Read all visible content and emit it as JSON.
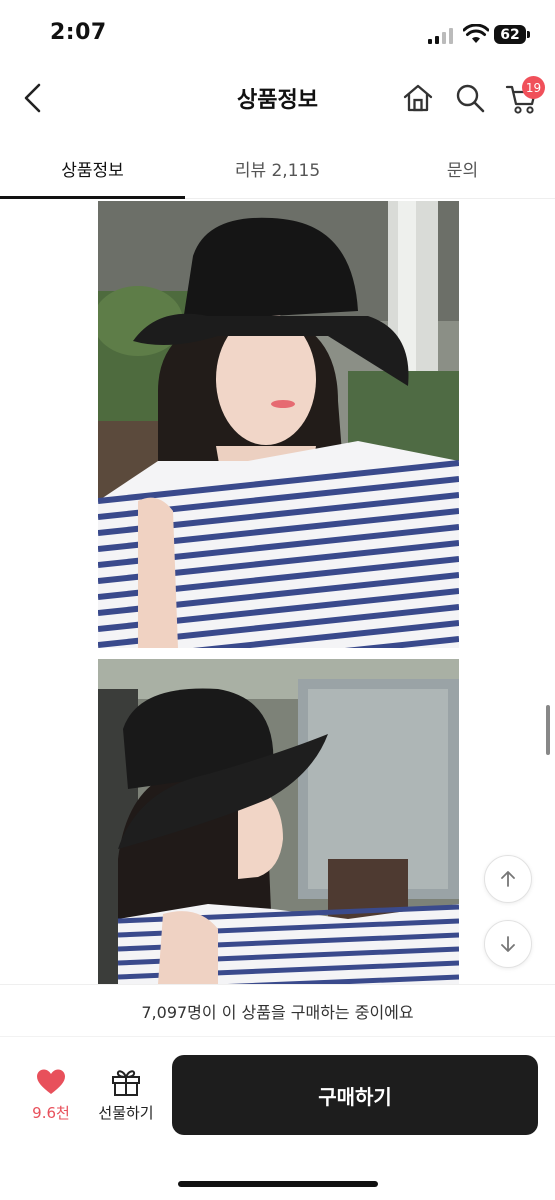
{
  "status": {
    "time": "2:07",
    "battery": "62"
  },
  "header": {
    "title": "상품정보",
    "cart_count": "19"
  },
  "tabs": [
    {
      "label": "상품정보",
      "active": true
    },
    {
      "label": "리뷰 2,115",
      "active": false
    },
    {
      "label": "문의",
      "active": false
    }
  ],
  "footer": {
    "buyers_text": "7,097명이 이 상품을 구매하는 중이에요",
    "like_count": "9.6천",
    "gift_label": "선물하기",
    "buy_label": "구매하기"
  },
  "colors": {
    "accent": "#f0505a",
    "buy_button": "#1d1d1d",
    "like": "#e8505b"
  }
}
